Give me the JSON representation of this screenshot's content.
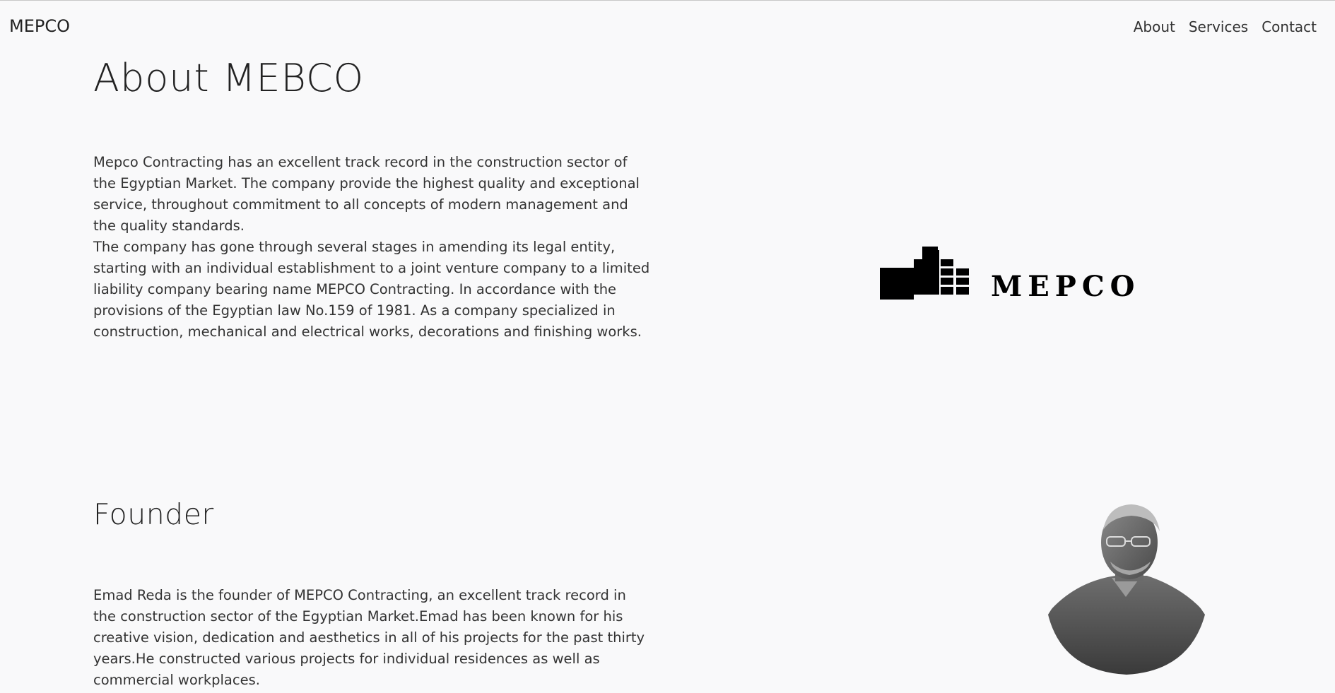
{
  "nav": {
    "brand": "MEPCO",
    "links": [
      "About",
      "Services",
      "Contact"
    ]
  },
  "about": {
    "title": "About MEBCO",
    "paragraphs": [
      "Mepco Contracting has an excellent track record in the construction sector of the Egyptian Market. The company provide the highest quality and exceptional service, throughout commitment to all concepts of modern management and the quality standards.",
      "The company has gone through several stages in amending its legal entity, starting with an individual establishment to a joint venture company to a limited liability company bearing name MEPCO Contracting. In accordance with the provisions of the Egyptian law No.159 of 1981. As a company specialized in construction, mechanical and electrical works, decorations and finishing works."
    ],
    "logo_text": "MEPCO"
  },
  "founder": {
    "title": "Founder",
    "paragraph": "Emad Reda is the founder of MEPCO Contracting, an excellent track record in the construction sector of the Egyptian Market.Emad has been known for his creative vision, dedication and aesthetics in all of his projects for the past thirty years.He constructed various projects for individual residences as well as commercial workplaces."
  },
  "colors": {
    "background": "#f9f9fa",
    "text": "#222222",
    "logo": "#000000"
  }
}
